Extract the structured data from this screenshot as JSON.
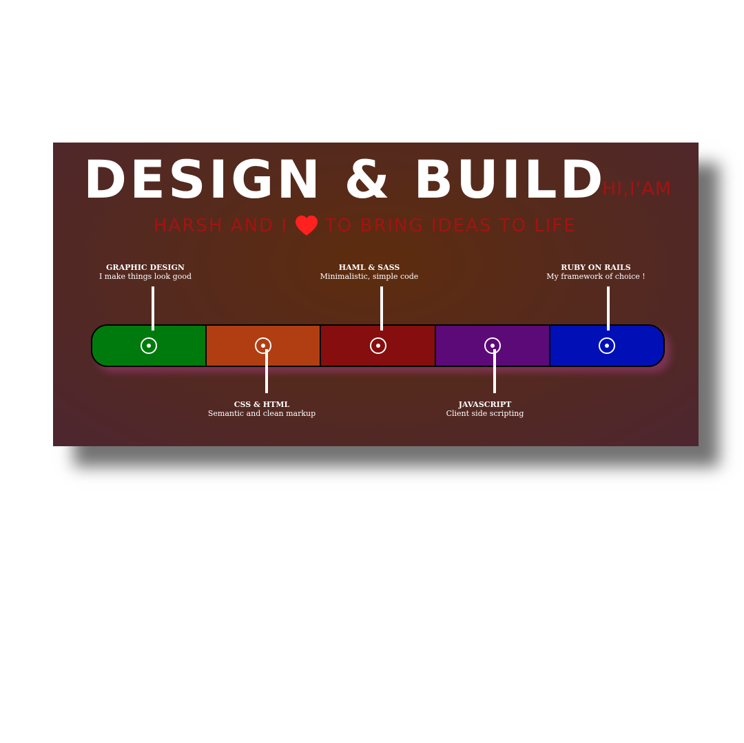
{
  "headline": "DESIGN & BUILD",
  "intro": "HI,I'AM",
  "tagline": {
    "before": "HARSH AND I",
    "heart_icon": "heart-icon",
    "after": "TO BRING IDEAS TO LIFE"
  },
  "colors": {
    "heart": "#ff2020",
    "tagline": "#a11412"
  },
  "skills": [
    {
      "title": "GRAPHIC DESIGN",
      "desc": "I make things look good",
      "color": "#007a0c"
    },
    {
      "title": "CSS & HTML",
      "desc": "Semantic and clean markup",
      "color": "#b03e12"
    },
    {
      "title": "HAML & SASS",
      "desc": "Minimalistic, simple code",
      "color": "#860e0e"
    },
    {
      "title": "JAVASCRIPT",
      "desc": "Client side scripting",
      "color": "#5c0a78"
    },
    {
      "title": "RUBY ON RAILS",
      "desc": "My framework of choice !",
      "color": "#0010b6"
    }
  ]
}
